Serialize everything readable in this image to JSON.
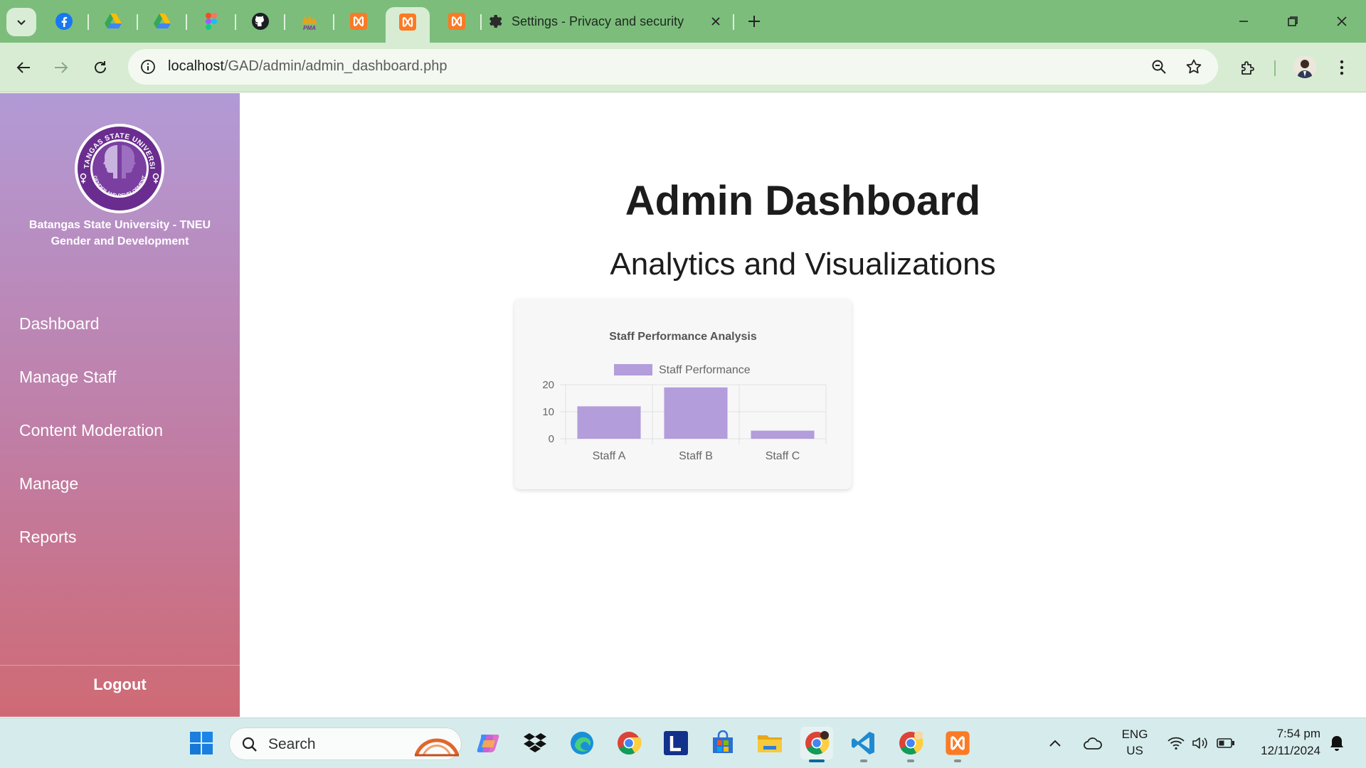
{
  "browser": {
    "pinned_tabs": [
      {
        "icon": "facebook-icon"
      },
      {
        "icon": "google-drive-icon"
      },
      {
        "icon": "google-drive-icon"
      },
      {
        "icon": "figma-icon"
      },
      {
        "icon": "github-icon"
      },
      {
        "icon": "pma-icon",
        "text": "PMA"
      },
      {
        "icon": "xampp-icon"
      },
      {
        "icon": "xampp-icon",
        "active": true
      },
      {
        "icon": "xampp-icon"
      }
    ],
    "active_tab_title": "Settings - Privacy and security",
    "url_host": "localhost",
    "url_path": "/GAD/admin/admin_dashboard.php"
  },
  "sidebar": {
    "logo_ring_text": "BATANGAS STATE UNIVERSITY",
    "logo_bottom_text": "GENDER AND DEVELOPMENT",
    "org_line1": "Batangas State University - TNEU",
    "org_line2": "Gender and Development",
    "items": [
      {
        "label": "Dashboard"
      },
      {
        "label": "Manage Staff"
      },
      {
        "label": "Content Moderation"
      },
      {
        "label": "Manage"
      },
      {
        "label": "Reports"
      }
    ],
    "logout_label": "Logout"
  },
  "main": {
    "page_title": "Admin Dashboard",
    "section_title": "Analytics and Visualizations"
  },
  "chart_data": {
    "type": "bar",
    "title": "Staff Performance Analysis",
    "categories": [
      "Staff A",
      "Staff B",
      "Staff C"
    ],
    "series": [
      {
        "name": "Staff Performance",
        "values": [
          12,
          19,
          3
        ],
        "color": "#b39ddb"
      }
    ],
    "ylim": [
      0,
      20
    ],
    "yticks": [
      0,
      10,
      20
    ],
    "xlabel": "",
    "ylabel": "",
    "grid": true,
    "legend": "top"
  },
  "taskbar": {
    "search_label": "Search",
    "lang_line1": "ENG",
    "lang_line2": "US",
    "time": "7:54 pm",
    "date": "12/11/2024"
  },
  "colors": {
    "browser_frame": "#7cbd7c",
    "sidebar_top": "#b29ad6",
    "sidebar_bottom": "#cf6a74",
    "bar": "#b39ddb"
  }
}
